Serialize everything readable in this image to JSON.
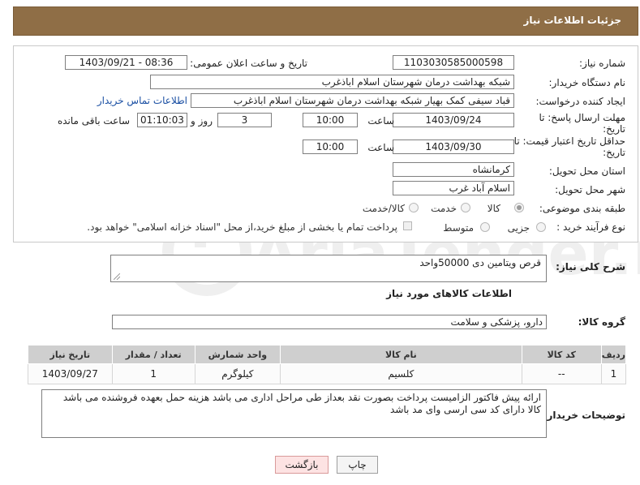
{
  "header": {
    "title": "جزئیات اطلاعات نیاز"
  },
  "form": {
    "need_number_label": "شماره نیاز:",
    "need_number": "1103030585000598",
    "announce_label": "تاریخ و ساعت اعلان عمومی:",
    "announce_value": "1403/09/21 - 08:36",
    "buyer_org_label": "نام دستگاه خریدار:",
    "buyer_org": "شبکه بهداشت درمان شهرستان اسلام اباذغرب",
    "requester_label": "ایجاد کننده درخواست:",
    "requester": "قباد سیفی کمک بهیار شبکه بهداشت درمان شهرستان اسلام اباذغرب",
    "contact_link": "اطلاعات تماس خریدار",
    "deadline_label_1": "مهلت ارسال پاسخ: تا",
    "deadline_label_2": "تاریخ:",
    "deadline_date": "1403/09/24",
    "time_label": "ساعت",
    "deadline_time": "10:00",
    "days": "3",
    "days_label": "روز و",
    "remaining_time": "01:10:03",
    "remaining_label": "ساعت باقی مانده",
    "validity_label_1": "حداقل تاریخ اعتبار قیمت: تا",
    "validity_label_2": "تاریخ:",
    "validity_date": "1403/09/30",
    "validity_time": "10:00",
    "province_label": "استان محل تحویل:",
    "province": "کرمانشاه",
    "city_label": "شهر محل تحویل:",
    "city": "اسلام آباد غرب",
    "category_label": "طبقه بندی موضوعی:",
    "category_options": {
      "goods": "کالا",
      "service": "خدمت",
      "goods_service": "کالا/خدمت"
    },
    "process_label": "نوع فرآیند خرید :",
    "process_options": {
      "partial": "جزیی",
      "medium": "متوسط"
    },
    "payment_note": "پرداخت تمام یا بخشی از مبلغ خرید،از محل \"اسناد خزانه اسلامی\" خواهد بود."
  },
  "description": {
    "label": "شرح کلی نیاز:",
    "value": "قرص ویتامین دی 50000واحد"
  },
  "goods_info": {
    "title": "اطلاعات کالاهای مورد نیاز",
    "group_label": "گروه کالا:",
    "group_value": "دارو، پزشکی و سلامت"
  },
  "table": {
    "headers": {
      "row": "ردیف",
      "code": "کد کالا",
      "name": "نام کالا",
      "unit": "واحد شمارش",
      "qty": "تعداد / مقدار",
      "date": "تاریخ نیاز"
    },
    "rows": [
      {
        "row": "1",
        "code": "--",
        "name": "کلسیم",
        "unit": "کیلوگرم",
        "qty": "1",
        "date": "1403/09/27"
      }
    ]
  },
  "buyer_notes": {
    "label": "توضیحات خریدار:",
    "value": "ارائه پیش فاکتور  الزامیست پرداخت بصورت نقد بعداز طی مراحل اداری می باشد  هزینه حمل بعهده فروشنده می باشد کالا دارای کد سی ارسی وای مد باشد"
  },
  "buttons": {
    "print": "چاپ",
    "back": "بازگشت"
  },
  "watermark": {
    "text": "AriaTender.neT"
  },
  "colors": {
    "header_bg": "#8f6e46",
    "link": "#1a4fa3",
    "back_bg": "#fde3e3"
  }
}
